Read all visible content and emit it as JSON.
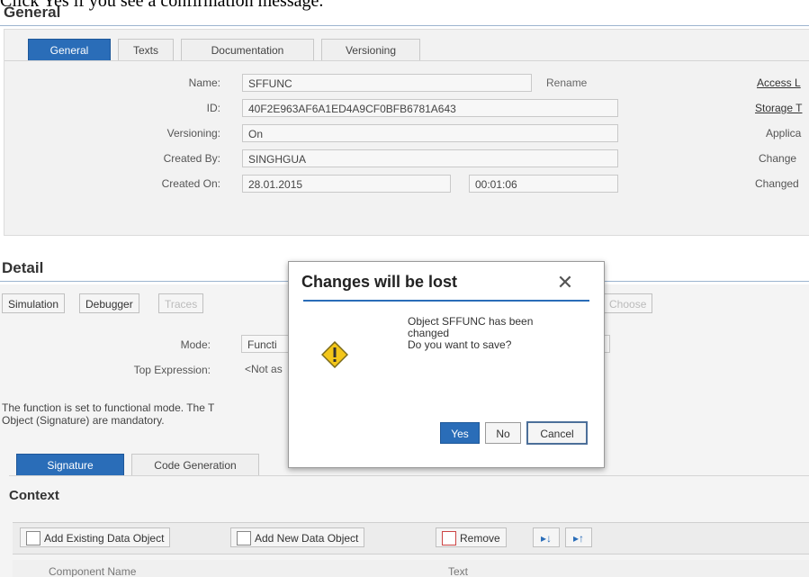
{
  "caption": "Click Yes if you see a confirmation message.",
  "general": {
    "title": "General",
    "tabs": [
      {
        "label": "General",
        "active": true
      },
      {
        "label": "Texts",
        "active": false
      },
      {
        "label": "Documentation",
        "active": false
      },
      {
        "label": "Versioning",
        "active": false
      }
    ],
    "fields": {
      "name_label": "Name:",
      "name_value": "SFFUNC",
      "rename": "Rename",
      "id_label": "ID:",
      "id_value": "40F2E963AF6A1ED4A9CF0BFB6781A643",
      "versioning_label": "Versioning:",
      "versioning_value": "On",
      "created_by_label": "Created By:",
      "created_by_value": "SINGHGUA",
      "created_on_label": "Created On:",
      "created_on_date": "28.01.2015",
      "created_on_time": "00:01:06"
    },
    "right_links": {
      "access": "Access L",
      "storage": "Storage T",
      "applic": "Applica",
      "changed1": "Change",
      "changed2": "Changed"
    }
  },
  "detail": {
    "title": "Detail",
    "toolbar": {
      "simulation": "Simulation",
      "debugger": "Debugger",
      "traces": "Traces",
      "choose": "Choose"
    },
    "mode_label": "Mode:",
    "mode_value": "Functi",
    "top_expr_label": "Top Expression:",
    "top_expr_value": "<Not as",
    "info_line1": "The function is set to functional mode. The T",
    "info_line2": "Object (Signature) are mandatory.",
    "subtabs": [
      {
        "label": "Signature",
        "active": true
      },
      {
        "label": "Code Generation",
        "active": false
      }
    ],
    "context_title": "Context",
    "context_toolbar": {
      "add_existing": "Add Existing Data Object",
      "add_new": "Add New Data Object",
      "remove": "Remove"
    },
    "table_headers": {
      "component_name": "Component Name",
      "text": "Text"
    }
  },
  "dialog": {
    "title": "Changes will be lost",
    "message_line1": "Object SFFUNC has been",
    "message_line2": "changed",
    "message_line3": "Do you want to save?",
    "yes": "Yes",
    "no": "No",
    "cancel": "Cancel",
    "icon": "warning-icon"
  },
  "colors": {
    "accent": "#2a6db8",
    "warning": "#f3c61a"
  }
}
